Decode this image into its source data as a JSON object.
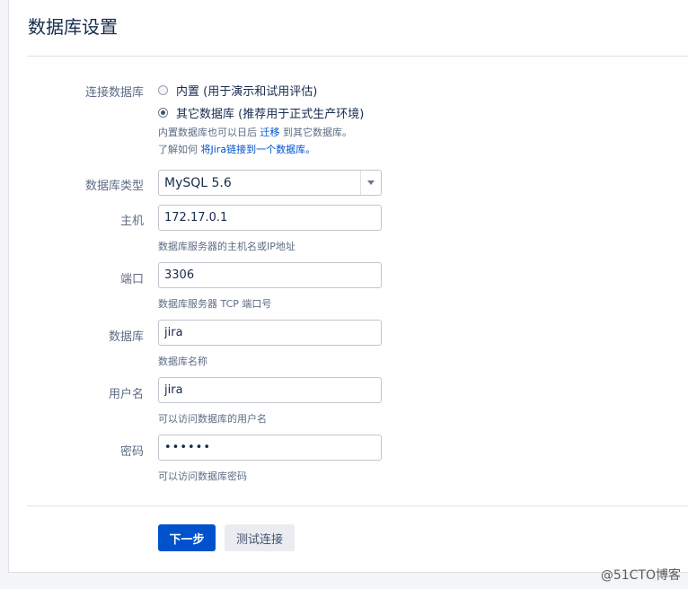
{
  "page": {
    "title": "数据库设置"
  },
  "connection": {
    "label": "连接数据库",
    "options": [
      {
        "label": "内置 (用于演示和试用评估)",
        "checked": false
      },
      {
        "label": "其它数据库 (推荐用于正式生产环境)",
        "checked": true
      }
    ],
    "help1_prefix": "内置数据库也可以日后 ",
    "help1_link": "迁移",
    "help1_suffix": " 到其它数据库。",
    "help2_prefix": "了解如何 ",
    "help2_link": "将Jira链接到一个数据库。"
  },
  "db_type": {
    "label": "数据库类型",
    "value": "MySQL 5.6"
  },
  "host": {
    "label": "主机",
    "value": "172.17.0.1",
    "help": "数据库服务器的主机名或IP地址"
  },
  "port": {
    "label": "端口",
    "value": "3306",
    "help": "数据库服务器 TCP 端口号"
  },
  "database": {
    "label": "数据库",
    "value": "jira",
    "help": "数据库名称"
  },
  "username": {
    "label": "用户名",
    "value": "jira",
    "help": "可以访问数据库的用户名"
  },
  "password": {
    "label": "密码",
    "value": "••••••",
    "help": "可以访问数据库密码"
  },
  "buttons": {
    "next": "下一步",
    "test": "测试连接"
  },
  "watermark": "@51CTO博客",
  "colors": {
    "primary": "#0052cc",
    "link": "#0052cc",
    "text": "#172b4d",
    "muted": "#5e6c84"
  },
  "icons": {
    "select_arrow": "chevron-down-icon"
  }
}
